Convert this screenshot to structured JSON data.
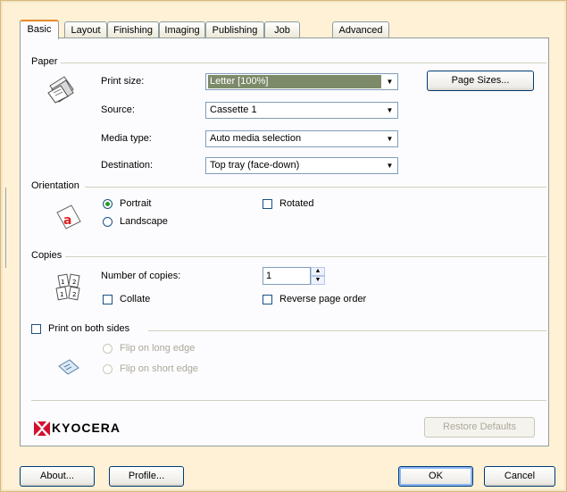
{
  "tabs": [
    "Basic",
    "Layout",
    "Finishing",
    "Imaging",
    "Publishing",
    "Job",
    "Advanced"
  ],
  "paper": {
    "title": "Paper",
    "print_size_label": "Print size:",
    "print_size_value": "Letter  [100%]",
    "source_label": "Source:",
    "source_value": "Cassette 1",
    "media_type_label": "Media type:",
    "media_type_value": "Auto media selection",
    "destination_label": "Destination:",
    "destination_value": "Top tray (face-down)",
    "page_sizes_button": "Page Sizes..."
  },
  "orientation": {
    "title": "Orientation",
    "portrait": "Portrait",
    "landscape": "Landscape",
    "rotated": "Rotated",
    "selected": "Portrait"
  },
  "copies": {
    "title": "Copies",
    "number_label": "Number of copies:",
    "number_value": "1",
    "collate": "Collate",
    "reverse": "Reverse page order"
  },
  "duplex": {
    "title": "Print on both sides",
    "long_edge": "Flip on long edge",
    "short_edge": "Flip on short edge"
  },
  "brand": "KYOCERA",
  "restore_defaults": "Restore Defaults",
  "footer": {
    "about": "About...",
    "profile": "Profile...",
    "ok": "OK",
    "cancel": "Cancel"
  },
  "colors": {
    "brand_red": "#d0102c",
    "tab_accent": "#e68b2c",
    "selection": "#7c8a6a"
  }
}
